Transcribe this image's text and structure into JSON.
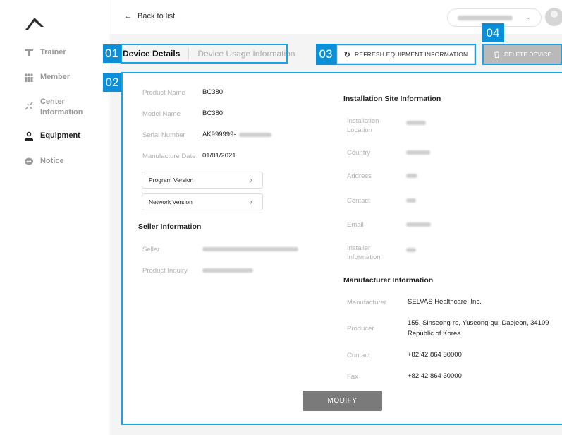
{
  "sidebar": {
    "items": [
      {
        "label": "Trainer",
        "icon": "trainer-icon"
      },
      {
        "label": "Member",
        "icon": "member-icon"
      },
      {
        "label_line1": "Center",
        "label_line2": "Information",
        "icon": "center-icon"
      },
      {
        "label": "Equipment",
        "icon": "equipment-icon"
      },
      {
        "label": "Notice",
        "icon": "notice-icon"
      }
    ]
  },
  "header": {
    "back_label": "Back to list"
  },
  "markers": [
    "01",
    "02",
    "03",
    "04"
  ],
  "tabs": {
    "active": "Device Details",
    "inactive": "Device Usage Information"
  },
  "buttons": {
    "refresh": "REFRESH EQUIPMENT INFORMATION",
    "delete": "DELETE DEVICE",
    "modify": "MODIFY"
  },
  "device": {
    "product_name_label": "Product Name",
    "product_name": "BC380",
    "model_name_label": "Model Name",
    "model_name": "BC380",
    "serial_label": "Serial Number",
    "serial_prefix": "AK999999-",
    "manufacture_date_label": "Manufacture Date",
    "manufacture_date": "01/01/2021",
    "program_version": "Program Version",
    "network_version": "Network Version"
  },
  "seller": {
    "title": "Seller Information",
    "seller_label": "Seller",
    "inquiry_label": "Product Inquiry"
  },
  "installation": {
    "title": "Installation Site Information",
    "location_label_1": "Installation",
    "location_label_2": "Location",
    "country_label": "Country",
    "address_label": "Address",
    "contact_label": "Contact",
    "email_label": "Email",
    "installer_label_1": "Installer",
    "installer_label_2": "Information"
  },
  "manufacturer": {
    "title": "Manufacturer Information",
    "manufacturer_label": "Manufacturer",
    "manufacturer": "SELVAS Healthcare, Inc.",
    "producer_label": "Producer",
    "producer_line1": "155, Sinseong-ro, Yuseong-gu, Daejeon, 34109",
    "producer_line2": "Republic of Korea",
    "contact_label": "Contact",
    "contact": "+82 42 864 30000",
    "fax_label": "Fax",
    "fax": "+82 42 864 30000"
  },
  "colors": {
    "accent": "#0a8fd8",
    "delete_bg": "#b9b9b9",
    "modify_bg": "#7a7a7a"
  }
}
